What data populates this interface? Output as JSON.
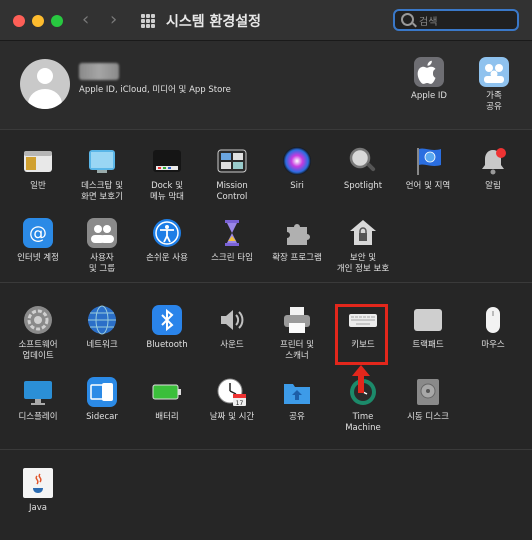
{
  "window": {
    "title": "시스템 환경설정"
  },
  "search": {
    "placeholder": "검색"
  },
  "account": {
    "subtitle": "Apple ID, iCloud, 미디어 및 App Store",
    "items": [
      {
        "label": "Apple ID",
        "icon": "apple-id-icon"
      },
      {
        "label": "가족\n공유",
        "icon": "family-sharing-icon"
      }
    ]
  },
  "section1": [
    {
      "label": "일반",
      "icon": "general-icon"
    },
    {
      "label": "데스크탑 및\n화면 보호기",
      "icon": "desktop-screensaver-icon"
    },
    {
      "label": "Dock 및\n메뉴 막대",
      "icon": "dock-icon"
    },
    {
      "label": "Mission\nControl",
      "icon": "mission-control-icon"
    },
    {
      "label": "Siri",
      "icon": "siri-icon"
    },
    {
      "label": "Spotlight",
      "icon": "spotlight-icon"
    },
    {
      "label": "언어 및 지역",
      "icon": "language-region-icon"
    },
    {
      "label": "알림",
      "icon": "notifications-icon"
    },
    {
      "label": "인터넷 계정",
      "icon": "internet-accounts-icon"
    },
    {
      "label": "사용자\n및 그룹",
      "icon": "users-groups-icon"
    },
    {
      "label": "손쉬운 사용",
      "icon": "accessibility-icon"
    },
    {
      "label": "스크린 타임",
      "icon": "screen-time-icon"
    },
    {
      "label": "확장 프로그램",
      "icon": "extensions-icon"
    },
    {
      "label": "보안 및\n개인 정보 보호",
      "icon": "security-privacy-icon"
    }
  ],
  "section2": [
    {
      "label": "소프트웨어\n업데이트",
      "icon": "software-update-icon"
    },
    {
      "label": "네트워크",
      "icon": "network-icon"
    },
    {
      "label": "Bluetooth",
      "icon": "bluetooth-icon"
    },
    {
      "label": "사운드",
      "icon": "sound-icon"
    },
    {
      "label": "프린터 및\n스캐너",
      "icon": "printer-icon"
    },
    {
      "label": "키보드",
      "icon": "keyboard-icon"
    },
    {
      "label": "트랙패드",
      "icon": "trackpad-icon"
    },
    {
      "label": "마우스",
      "icon": "mouse-icon"
    },
    {
      "label": "디스플레이",
      "icon": "display-icon"
    },
    {
      "label": "Sidecar",
      "icon": "sidecar-icon"
    },
    {
      "label": "배터리",
      "icon": "battery-icon"
    },
    {
      "label": "날짜 및 시간",
      "icon": "date-time-icon"
    },
    {
      "label": "공유",
      "icon": "sharing-icon"
    },
    {
      "label": "Time\nMachine",
      "icon": "time-machine-icon"
    },
    {
      "label": "시동 디스크",
      "icon": "startup-disk-icon"
    }
  ],
  "section3": [
    {
      "label": "Java",
      "icon": "java-icon"
    }
  ],
  "calendar_day": "17"
}
